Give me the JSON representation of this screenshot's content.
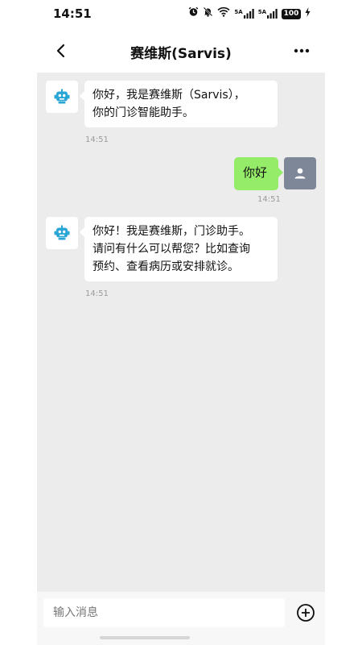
{
  "status_bar": {
    "time": "14:51",
    "signal_1_label": "5A",
    "signal_2_label": "5A",
    "battery_level": "100"
  },
  "header": {
    "title": "赛维斯(Sarvis)",
    "back_icon": "chevron-left-icon",
    "more_icon": "more-horizontal-icon"
  },
  "messages": [
    {
      "sender": "bot",
      "lines": [
        "你好，我是赛维斯（Sarvis），",
        "你的门诊智能助手。"
      ],
      "time": "14:51"
    },
    {
      "sender": "user",
      "lines": [
        "你好"
      ],
      "time": "14:51"
    },
    {
      "sender": "bot",
      "lines": [
        "你好！我是赛维斯，门诊助手。",
        "请问有什么可以帮您？比如查询",
        "预约、查看病历或安排就诊。"
      ],
      "time": "14:51"
    }
  ],
  "input": {
    "placeholder": "输入消息",
    "value": ""
  },
  "colors": {
    "bot_icon": "#2aa6d6",
    "user_bubble": "#95ec69",
    "chat_background": "#ececec",
    "user_avatar": "#7d8797"
  }
}
